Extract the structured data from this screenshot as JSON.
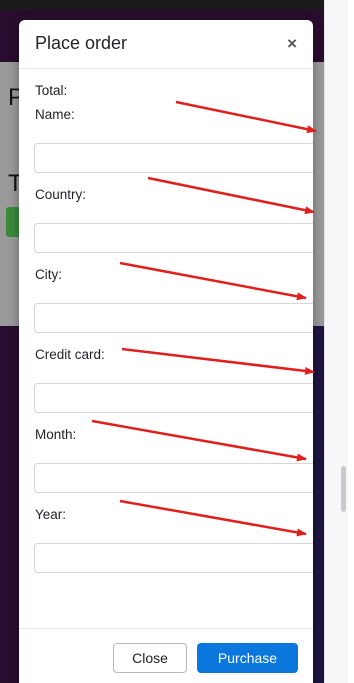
{
  "modal": {
    "title": "Place order",
    "close_x": "×",
    "total_label": "Total:",
    "fields": [
      {
        "label": "Name:",
        "value": "",
        "placeholder": ""
      },
      {
        "label": "Country:",
        "value": "",
        "placeholder": ""
      },
      {
        "label": "City:",
        "value": "",
        "placeholder": ""
      },
      {
        "label": "Credit card:",
        "value": "",
        "placeholder": ""
      },
      {
        "label": "Month:",
        "value": "",
        "placeholder": ""
      },
      {
        "label": "Year:",
        "value": "",
        "placeholder": ""
      }
    ],
    "footer": {
      "close_label": "Close",
      "purchase_label": "Purchase"
    }
  },
  "background": {
    "letters": [
      "P",
      "T"
    ]
  },
  "colors": {
    "purchase_button": "#0b77dc",
    "annotation_arrow": "#e0201c",
    "backdrop": "#2a0d2e"
  }
}
